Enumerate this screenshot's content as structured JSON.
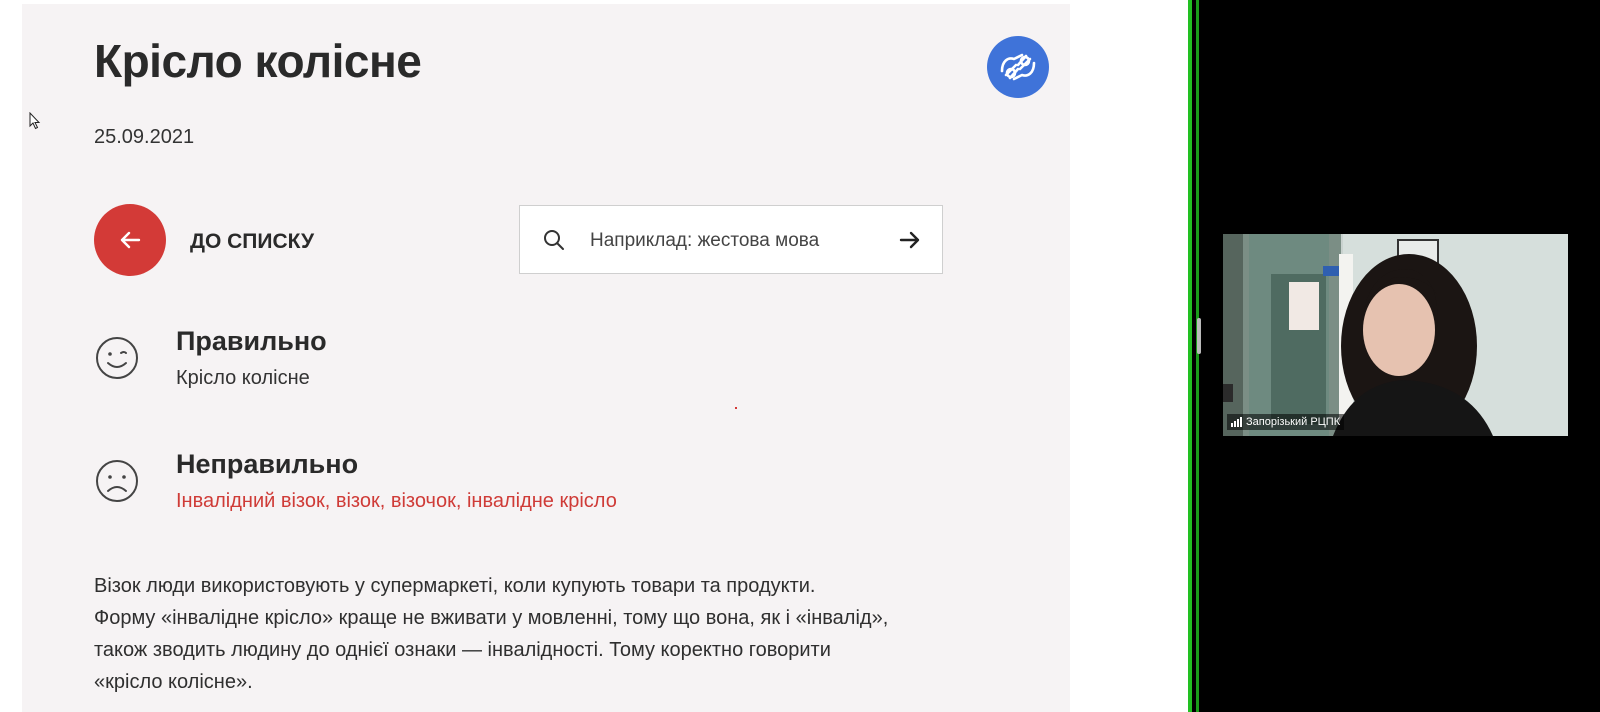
{
  "page": {
    "title": "Крісло колісне",
    "date": "25.09.2021",
    "back_label": "до списку",
    "search": {
      "placeholder": "Наприклад: жестова мова"
    },
    "correct": {
      "heading": "Правильно",
      "value": "Крісло колісне"
    },
    "incorrect": {
      "heading": "Неправильно",
      "value": "Інвалідний візок, візок, візочок, інвалідне крісло"
    },
    "explanation_lines": [
      "Візок люди використовують у супермаркеті, коли купують товари та продукти.",
      "Форму «інвалідне крісло» краще не вживати у мовленні, тому що вона, як і «інвалід»,",
      "також зводить людину до однієї ознаки — інвалідності. Тому коректно говорити",
      "«крісло колісне»."
    ]
  },
  "video_call": {
    "participant_name": "Запорізький РЦПК"
  },
  "colors": {
    "accent_red": "#d33a37",
    "sign_language_blue": "#3f73d9",
    "call_border_green": "#22c022"
  }
}
